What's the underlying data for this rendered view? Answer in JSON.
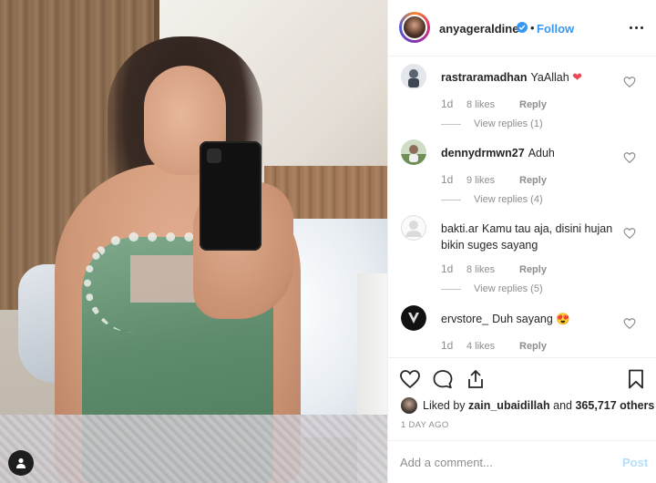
{
  "post": {
    "username": "anyageraldine",
    "separator": "•",
    "follow_label": "Follow"
  },
  "comments": [
    {
      "username": "rastraramadhan",
      "text": "YaAllah",
      "emoji": "❤",
      "time": "1d",
      "likes": "8 likes",
      "reply_label": "Reply",
      "view_replies": "View replies (1)"
    },
    {
      "username": "dennydrmwn27",
      "text": "Aduh",
      "time": "1d",
      "likes": "9 likes",
      "reply_label": "Reply",
      "view_replies": "View replies (4)"
    },
    {
      "username": "bakti.ar",
      "text": "Kamu tau aja, disini hujan bikin suges sayang",
      "time": "1d",
      "likes": "8 likes",
      "reply_label": "Reply",
      "view_replies": "View replies (5)"
    },
    {
      "username": "ervstore_",
      "text": "Duh sayang",
      "emoji": "😍",
      "time": "1d",
      "likes": "4 likes",
      "reply_label": "Reply"
    }
  ],
  "likes_summary": {
    "prefix": "Liked by",
    "user": "zain_ubaidillah",
    "and": "and",
    "count": "365,717 others"
  },
  "time_ago": "1 DAY AGO",
  "comment_box": {
    "placeholder": "Add a comment...",
    "post_label": "Post"
  },
  "colors": {
    "accent": "#3897f0",
    "heart": "#ed4956",
    "muted": "#8e8e8e"
  }
}
